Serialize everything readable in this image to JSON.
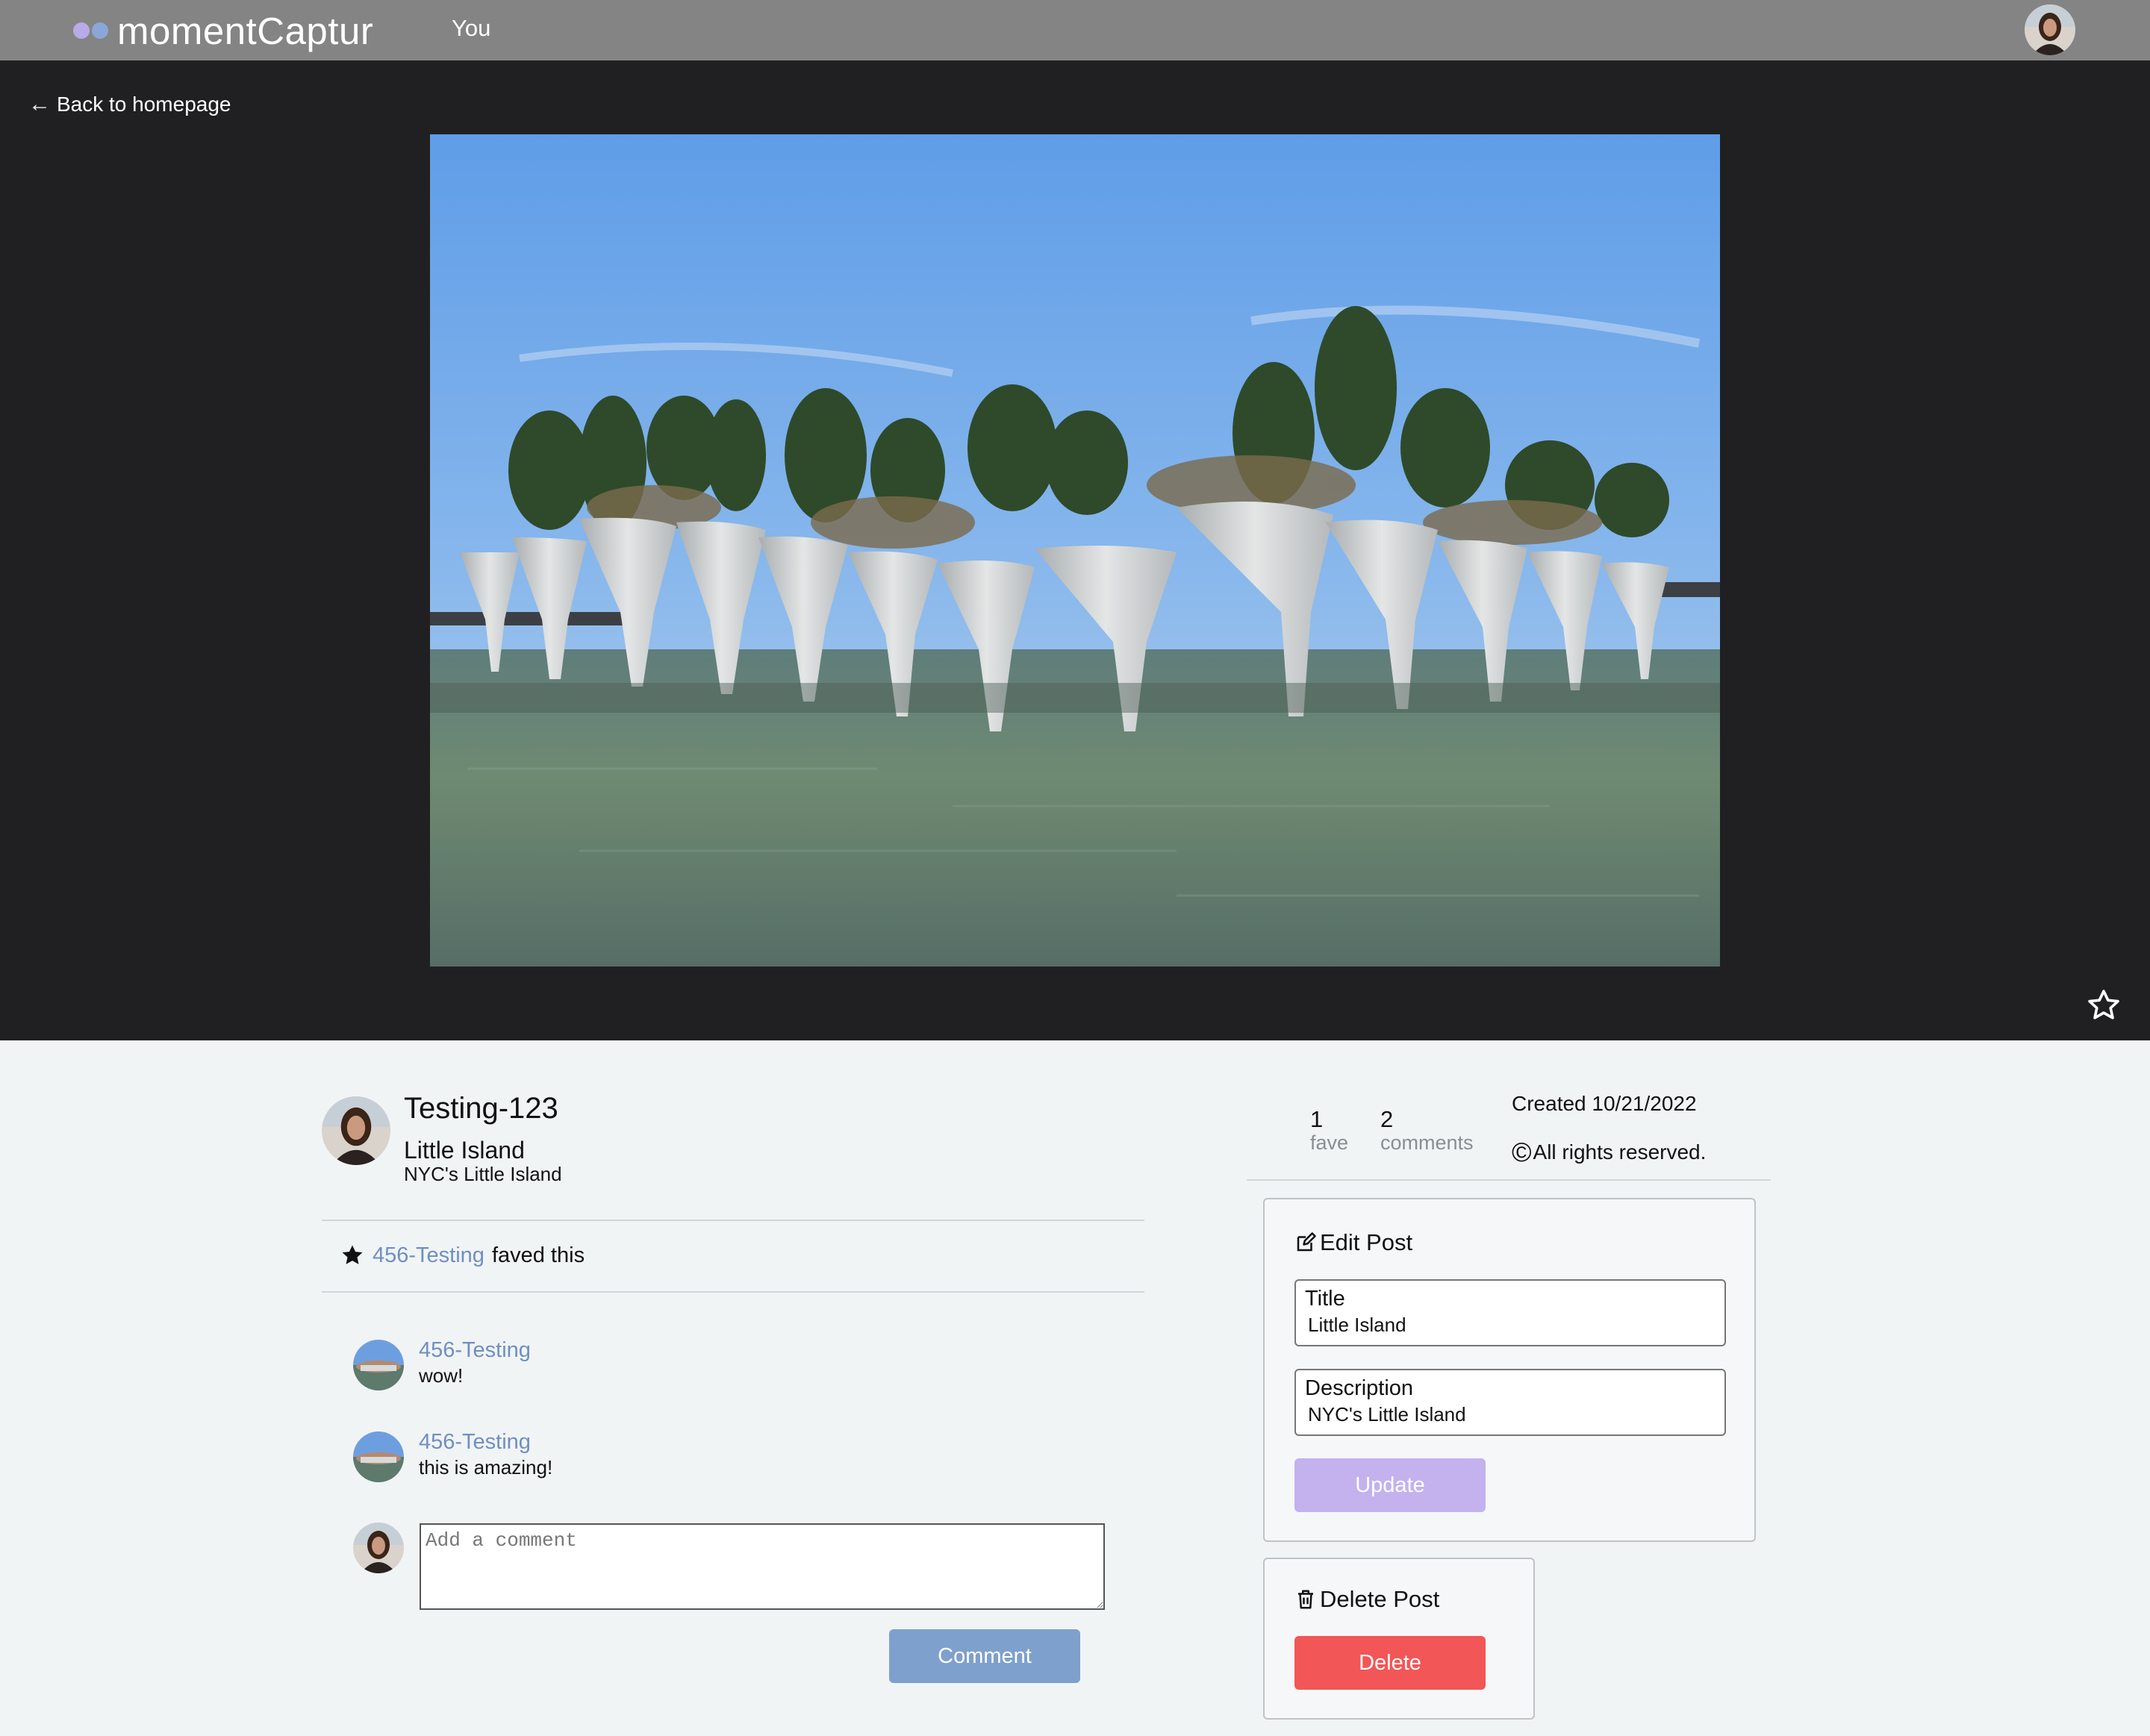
{
  "nav": {
    "brand": "momentCaptur",
    "you_label": "You"
  },
  "hero": {
    "back_label": "Back to homepage"
  },
  "post": {
    "author": "Testing-123",
    "title": "Little Island",
    "description": "NYC's Little Island",
    "faved_by": "456-Testing",
    "faved_text": "faved this"
  },
  "stats": {
    "faves_count": "1",
    "faves_label": "fave",
    "comments_count": "2",
    "comments_label": "comments",
    "created": "Created 10/21/2022",
    "rights": "All rights reserved.",
    "copyright_symbol": "©"
  },
  "comments": [
    {
      "user": "456-Testing",
      "text": "wow!"
    },
    {
      "user": "456-Testing",
      "text": "this is amazing!"
    }
  ],
  "new_comment": {
    "placeholder": "Add a comment",
    "button_label": "Comment"
  },
  "edit": {
    "heading": "Edit Post",
    "title_label": "Title",
    "title_value": "Little Island",
    "description_label": "Description",
    "description_value": "NYC's Little Island",
    "update_label": "Update"
  },
  "delete": {
    "heading": "Delete Post",
    "button_label": "Delete"
  },
  "colors": {
    "nav_bg": "#848484",
    "hero_bg": "#202022",
    "link_blue": "#6f8fc0",
    "comment_button": "#7ea0cc",
    "update_button": "#c3b2ee",
    "delete_button": "#f25656"
  }
}
